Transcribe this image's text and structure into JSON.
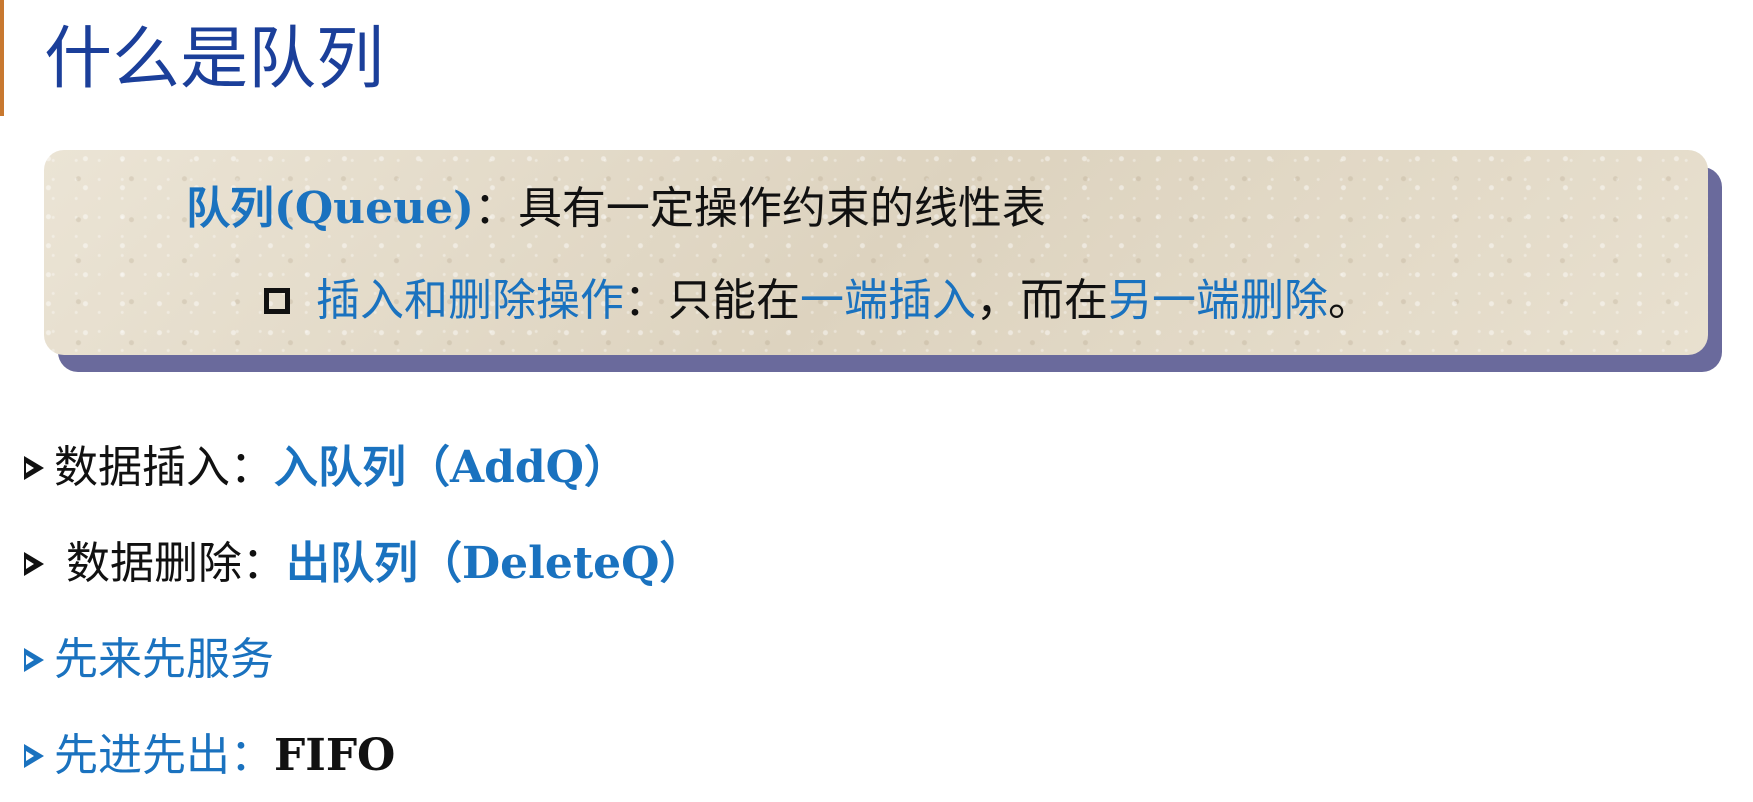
{
  "slide": {
    "title": "什么是队列"
  },
  "definition": {
    "term": "队列(Queue)",
    "separator": "：",
    "text": "具有一定操作约束的线性表",
    "sub": {
      "label": "插入和删除操作",
      "separator": "：",
      "text_1": "只能在",
      "blue_1": "一端插入",
      "text_2": "，而在",
      "blue_2": "另一端删除",
      "text_3": "。"
    }
  },
  "bullets": [
    {
      "label": "数据插入：",
      "value": "入队列（AddQ）"
    },
    {
      "label": "数据删除：",
      "value": "出队列（DeleteQ）"
    },
    {
      "label": "先来先服务"
    },
    {
      "label": "先进先出：",
      "value": "FIFO"
    }
  ],
  "colors": {
    "title": "#1b3f9a",
    "accent": "#1a72bf",
    "accent_bar": "#c8782f",
    "box_shadow": "#6a6a9c"
  },
  "icons": {
    "square_bullet": "hollow-square-icon",
    "arrow_bullet": "arrowhead-icon"
  }
}
